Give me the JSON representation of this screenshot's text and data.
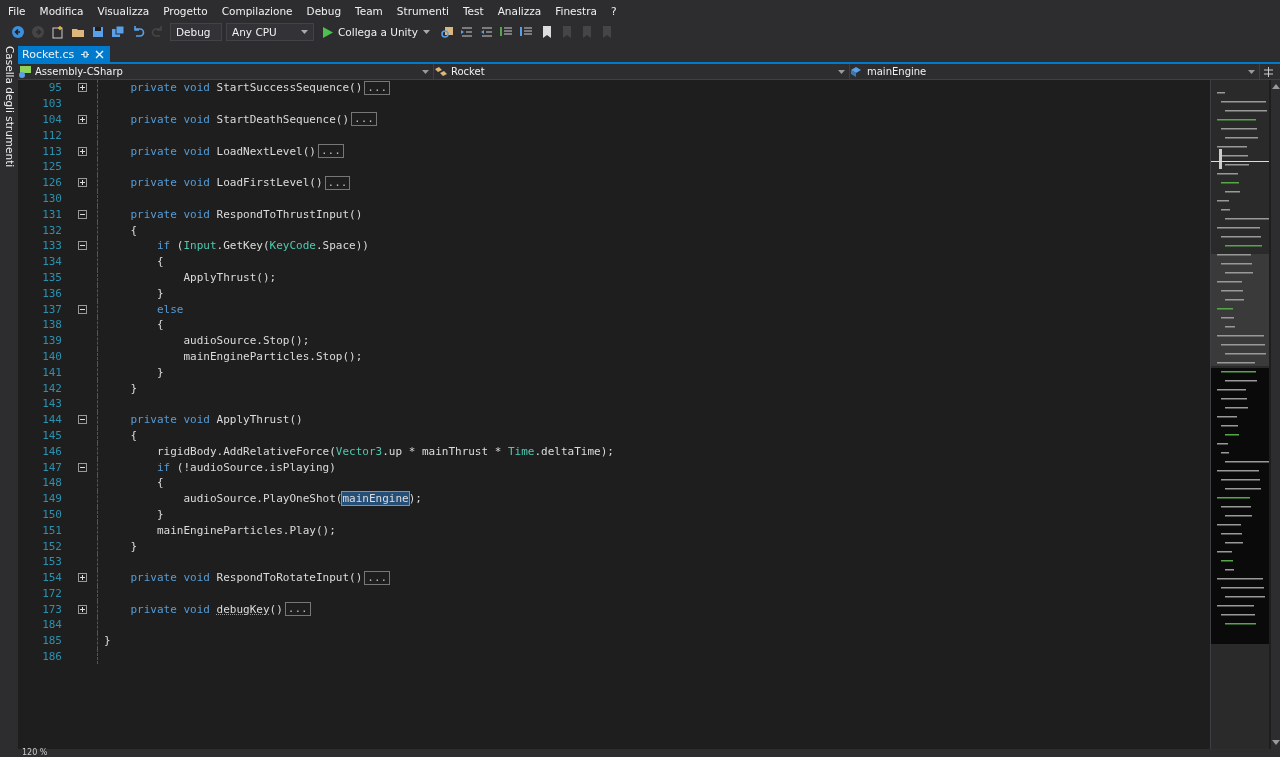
{
  "menu": [
    "File",
    "Modifica",
    "Visualizza",
    "Progetto",
    "Compilazione",
    "Debug",
    "Team",
    "Strumenti",
    "Test",
    "Analizza",
    "Finestra",
    "?"
  ],
  "toolbar": {
    "left_buttons": [
      {
        "kind": "back",
        "disabled": false
      },
      {
        "kind": "forward",
        "disabled": true
      },
      {
        "kind": "new",
        "disabled": false
      },
      {
        "kind": "open",
        "disabled": false
      },
      {
        "kind": "save",
        "disabled": false
      },
      {
        "kind": "saveall",
        "disabled": false
      },
      {
        "kind": "undo",
        "disabled": false
      },
      {
        "kind": "redo",
        "disabled": true
      }
    ],
    "configuration": "Debug",
    "platform": "Any CPU",
    "run_label": "Collega a Unity",
    "right_buttons": [
      {
        "kind": "find",
        "disabled": false
      },
      {
        "kind": "outdent",
        "disabled": false
      },
      {
        "kind": "indent",
        "disabled": false
      },
      {
        "kind": "comment",
        "disabled": false
      },
      {
        "kind": "uncomment",
        "disabled": false
      },
      {
        "kind": "bookmark",
        "disabled": false
      },
      {
        "kind": "prevbookmark",
        "disabled": true
      },
      {
        "kind": "nextbookmark",
        "disabled": true
      },
      {
        "kind": "clearbookmark",
        "disabled": true
      }
    ]
  },
  "side_panel": {
    "label": "Casella degli strumenti"
  },
  "tabs": [
    {
      "label": "Rocket.cs",
      "selected": true
    }
  ],
  "navigation": {
    "project": "Assembly-CSharp",
    "type": "Rocket",
    "member": "mainEngine"
  },
  "lines": [
    {
      "number": "95",
      "expanded": false,
      "tokens": [
        {
          "kind": "keyword",
          "text": "    private void"
        },
        {
          "kind": "plain",
          "text": " StartSuccessSequence()"
        }
      ],
      "collapsed": "..."
    },
    {
      "number": "103"
    },
    {
      "number": "104",
      "expanded": false,
      "tokens": [
        {
          "kind": "keyword",
          "text": "    private void"
        },
        {
          "kind": "plain",
          "text": " StartDeathSequence()"
        }
      ],
      "collapsed": "..."
    },
    {
      "number": "112"
    },
    {
      "number": "113",
      "expanded": false,
      "tokens": [
        {
          "kind": "keyword",
          "text": "    private void"
        },
        {
          "kind": "plain",
          "text": " LoadNextLevel()"
        }
      ],
      "collapsed": "..."
    },
    {
      "number": "125"
    },
    {
      "number": "126",
      "expanded": false,
      "tokens": [
        {
          "kind": "keyword",
          "text": "    private void"
        },
        {
          "kind": "plain",
          "text": " LoadFirstLevel()"
        }
      ],
      "collapsed": "..."
    },
    {
      "number": "130"
    },
    {
      "number": "131",
      "expanded": true,
      "tokens": [
        {
          "kind": "keyword",
          "text": "    private void"
        },
        {
          "kind": "plain",
          "text": " RespondToThrustInput()"
        }
      ]
    },
    {
      "number": "132",
      "tokens": [
        {
          "kind": "plain",
          "text": "    {"
        }
      ]
    },
    {
      "number": "133",
      "expanded": true,
      "tokens": [
        {
          "kind": "keyword",
          "text": "        if"
        },
        {
          "kind": "plain",
          "text": " ("
        },
        {
          "kind": "type",
          "text": "Input"
        },
        {
          "kind": "plain",
          "text": ".GetKey("
        },
        {
          "kind": "type",
          "text": "KeyCode"
        },
        {
          "kind": "plain",
          "text": ".Space))"
        }
      ]
    },
    {
      "number": "134",
      "tokens": [
        {
          "kind": "plain",
          "text": "        {"
        }
      ]
    },
    {
      "number": "135",
      "tokens": [
        {
          "kind": "plain",
          "text": "            ApplyThrust();"
        }
      ]
    },
    {
      "number": "136",
      "tokens": [
        {
          "kind": "plain",
          "text": "        }"
        }
      ]
    },
    {
      "number": "137",
      "expanded": true,
      "tokens": [
        {
          "kind": "keyword",
          "text": "        else"
        }
      ]
    },
    {
      "number": "138",
      "tokens": [
        {
          "kind": "plain",
          "text": "        {"
        }
      ]
    },
    {
      "number": "139",
      "tokens": [
        {
          "kind": "plain",
          "text": "            audioSource.Stop();"
        }
      ]
    },
    {
      "number": "140",
      "tokens": [
        {
          "kind": "plain",
          "text": "            mainEngineParticles.Stop();"
        }
      ]
    },
    {
      "number": "141",
      "tokens": [
        {
          "kind": "plain",
          "text": "        }"
        }
      ]
    },
    {
      "number": "142",
      "tokens": [
        {
          "kind": "plain",
          "text": "    }"
        }
      ]
    },
    {
      "number": "143"
    },
    {
      "number": "144",
      "expanded": true,
      "tokens": [
        {
          "kind": "keyword",
          "text": "    private void"
        },
        {
          "kind": "plain",
          "text": " ApplyThrust()"
        }
      ]
    },
    {
      "number": "145",
      "tokens": [
        {
          "kind": "plain",
          "text": "    {"
        }
      ]
    },
    {
      "number": "146",
      "tokens": [
        {
          "kind": "plain",
          "text": "        rigidBody.AddRelativeForce("
        },
        {
          "kind": "type",
          "text": "Vector3"
        },
        {
          "kind": "plain",
          "text": ".up * mainThrust * "
        },
        {
          "kind": "type",
          "text": "Time"
        },
        {
          "kind": "plain",
          "text": ".deltaTime);"
        }
      ]
    },
    {
      "number": "147",
      "expanded": true,
      "tokens": [
        {
          "kind": "keyword",
          "text": "        if"
        },
        {
          "kind": "plain",
          "text": " (!audioSource.isPlaying)"
        }
      ]
    },
    {
      "number": "148",
      "tokens": [
        {
          "kind": "plain",
          "text": "        {"
        }
      ]
    },
    {
      "number": "149",
      "tokens": [
        {
          "kind": "plain",
          "text": "            audioSource.PlayOneShot("
        },
        {
          "kind": "highlight",
          "text": "mainEngine"
        },
        {
          "kind": "plain",
          "text": ");"
        }
      ]
    },
    {
      "number": "150",
      "tokens": [
        {
          "kind": "plain",
          "text": "        }"
        }
      ]
    },
    {
      "number": "151",
      "tokens": [
        {
          "kind": "plain",
          "text": "        mainEngineParticles.Play();"
        }
      ]
    },
    {
      "number": "152",
      "tokens": [
        {
          "kind": "plain",
          "text": "    }"
        }
      ]
    },
    {
      "number": "153"
    },
    {
      "number": "154",
      "expanded": false,
      "tokens": [
        {
          "kind": "keyword",
          "text": "    private void"
        },
        {
          "kind": "plain",
          "text": " RespondToRotateInput()"
        }
      ],
      "collapsed": "..."
    },
    {
      "number": "172"
    },
    {
      "number": "173",
      "expanded": false,
      "tokens": [
        {
          "kind": "keyword",
          "text": "    private void "
        },
        {
          "kind": "suggestion",
          "text": "debugKey"
        },
        {
          "kind": "plain",
          "text": "()"
        }
      ],
      "collapsed": "..."
    },
    {
      "number": "184"
    },
    {
      "number": "185",
      "tokens": [
        {
          "kind": "plain",
          "text": "}"
        }
      ]
    },
    {
      "number": "186"
    }
  ],
  "status": {
    "zoom": "120 %"
  }
}
